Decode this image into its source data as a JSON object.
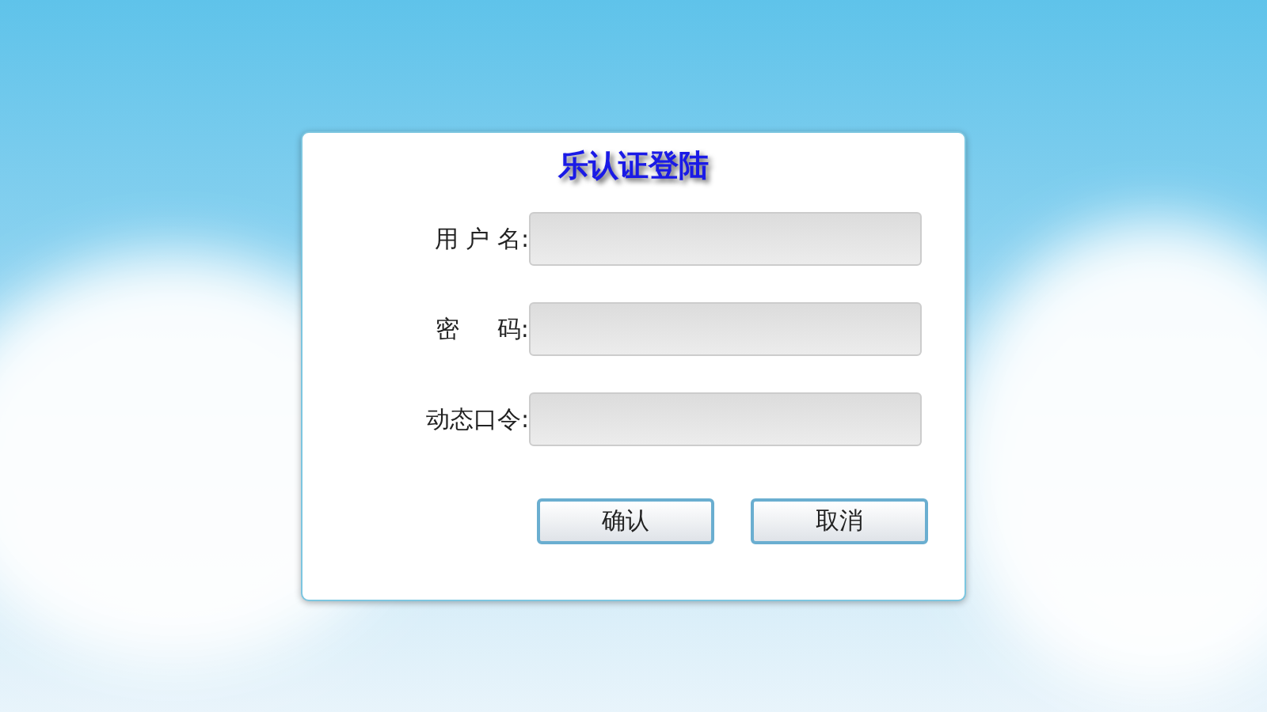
{
  "dialog": {
    "title": "乐认证登陆",
    "fields": [
      {
        "label": "用 户 名:"
      },
      {
        "label": "密     码:"
      },
      {
        "label": "动态口令:"
      }
    ],
    "buttons": [
      "确认",
      "取消"
    ]
  }
}
